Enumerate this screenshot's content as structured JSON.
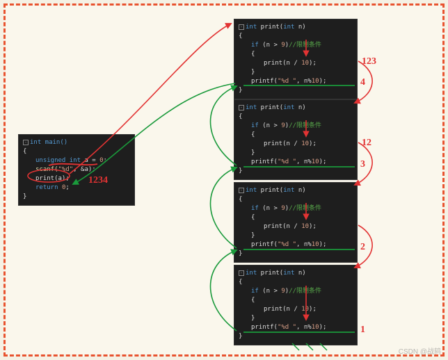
{
  "main": {
    "sig": "int main()",
    "l1_a": "unsigned int",
    "l1_b": " a = ",
    "l1_c": "0",
    "l1_d": ";",
    "l2_a": "scanf(",
    "l2_b": "\"%d\"",
    "l2_c": ", &a);",
    "l3": "print(a);",
    "l4_a": "return ",
    "l4_b": "0",
    "l4_c": ";"
  },
  "printfn": {
    "sig_a": "int",
    "sig_b": " print(",
    "sig_c": "int",
    "sig_d": " n)",
    "if_a": "if",
    "if_b": " (n > ",
    "if_c": "9",
    "if_d": ")",
    "if_cmt": "//限制条件",
    "rec": "print(n / ",
    "rec_n": "10",
    "rec_e": ");",
    "pf_a": "printf(",
    "pf_s": "\"%d \"",
    "pf_b": ", n%",
    "pf_n": "10",
    "pf_e": ");"
  },
  "annot": {
    "a_main": "1234",
    "a1": "123",
    "a1b": "4",
    "a2": "12",
    "a2b": "3",
    "a3": "2",
    "a4": "1"
  },
  "brace_open": "{",
  "brace_close": "}",
  "watermark": "CSDN @战鸫"
}
